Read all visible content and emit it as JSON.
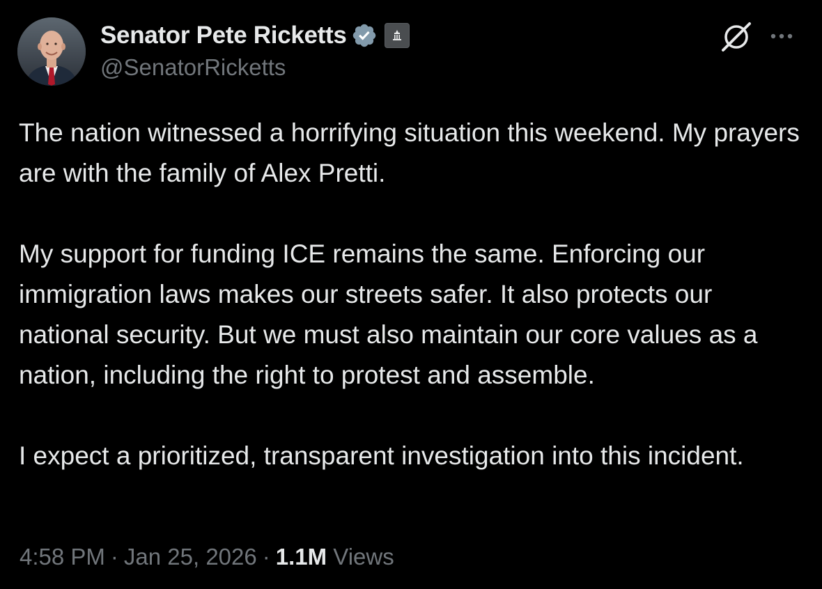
{
  "author": {
    "display_name": "Senator Pete Ricketts",
    "handle": "@SenatorRicketts",
    "verified_color": "#829aab",
    "badge": "government-building-icon"
  },
  "tweet": {
    "paragraphs": [
      "The nation witnessed a horrifying situation this weekend. My prayers are with the family of Alex Pretti.",
      "My support for funding ICE remains the same. Enforcing our immigration laws makes our streets safer. It also protects our national security. But we must also maintain our core values as a nation, including the right to protest and assemble.",
      "I expect a prioritized, transparent investigation into this incident."
    ],
    "time": "4:58 PM",
    "date": "Jan 25, 2026",
    "views_count": "1.1M",
    "views_label": "Views"
  },
  "icons": {
    "grok": "grok-icon",
    "more": "more-options-icon"
  },
  "colors": {
    "background": "#000000",
    "text_primary": "#e7e9ea",
    "text_secondary": "#71767b"
  }
}
